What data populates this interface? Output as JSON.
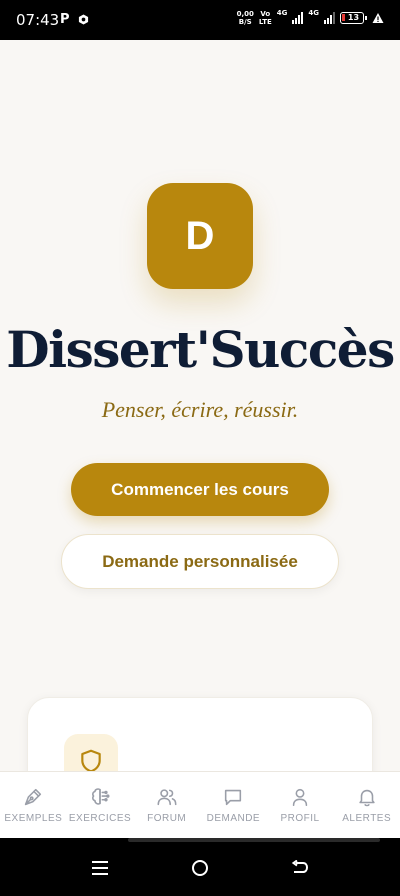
{
  "status_bar": {
    "time": "07:43",
    "notif_p": "P",
    "net_speed_value": "0,00",
    "net_speed_unit": "B/S",
    "volte_top": "Vo",
    "volte_bottom": "LTE",
    "sim1": "4G",
    "sim2": "4G",
    "battery": "13"
  },
  "hero": {
    "logo_letter": "D",
    "title": "Dissert'Succès",
    "tagline": "Penser, écrire, réussir."
  },
  "actions": {
    "primary_label": "Commencer les cours",
    "secondary_label": "Demande personnalisée"
  },
  "feature_card": {
    "icon": "shield-icon"
  },
  "nav": {
    "items": [
      {
        "label": "EXEMPLES",
        "icon": "pen-nib-icon"
      },
      {
        "label": "EXERCICES",
        "icon": "brain-icon"
      },
      {
        "label": "FORUM",
        "icon": "users-icon"
      },
      {
        "label": "DEMANDE",
        "icon": "message-square-icon"
      },
      {
        "label": "PROFIL",
        "icon": "user-icon"
      },
      {
        "label": "ALERTES",
        "icon": "bell-icon"
      }
    ]
  },
  "colors": {
    "accent": "#b8870d",
    "title": "#0f1d35",
    "tagline": "#8b6a14",
    "background": "#f9f7f4",
    "nav_icon": "#9a9ea8"
  }
}
